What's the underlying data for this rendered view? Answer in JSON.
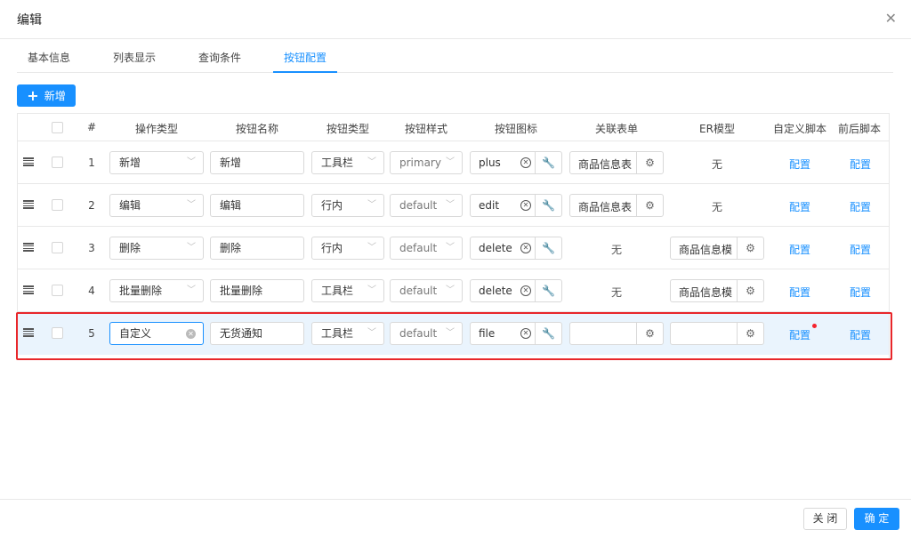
{
  "modal": {
    "title": "编辑",
    "close_glyph": "✕"
  },
  "tabs": [
    {
      "label": "基本信息",
      "active": false
    },
    {
      "label": "列表显示",
      "active": false
    },
    {
      "label": "查询条件",
      "active": false
    },
    {
      "label": "按钮配置",
      "active": true
    }
  ],
  "toolbar": {
    "add_label": "新增",
    "add_glyph": "+"
  },
  "table": {
    "headers": {
      "index": "#",
      "op_type": "操作类型",
      "btn_name": "按钮名称",
      "btn_type": "按钮类型",
      "btn_style": "按钮样式",
      "btn_icon": "按钮图标",
      "related_form": "关联表单",
      "er_model": "ER模型",
      "custom_script": "自定义脚本",
      "pre_post_script": "前后脚本"
    },
    "rows": [
      {
        "index": "1",
        "op_type": "新增",
        "btn_name": "新增",
        "btn_type": "工具栏",
        "btn_style": "primary",
        "icon": "plus",
        "related_form": "商品信息表",
        "er_model": "无",
        "custom_script": "配置",
        "pre_post_script": "配置"
      },
      {
        "index": "2",
        "op_type": "编辑",
        "btn_name": "编辑",
        "btn_type": "行内",
        "btn_style": "default",
        "icon": "edit",
        "related_form": "商品信息表",
        "er_model": "无",
        "custom_script": "配置",
        "pre_post_script": "配置"
      },
      {
        "index": "3",
        "op_type": "删除",
        "btn_name": "删除",
        "btn_type": "行内",
        "btn_style": "default",
        "icon": "delete",
        "related_form": "无",
        "er_model": "商品信息模",
        "custom_script": "配置",
        "pre_post_script": "配置"
      },
      {
        "index": "4",
        "op_type": "批量删除",
        "btn_name": "批量删除",
        "btn_type": "工具栏",
        "btn_style": "default",
        "icon": "delete",
        "related_form": "无",
        "er_model": "商品信息模",
        "custom_script": "配置",
        "pre_post_script": "配置"
      },
      {
        "index": "5",
        "op_type": "自定义",
        "btn_name": "无货通知",
        "btn_type": "工具栏",
        "btn_style": "default",
        "icon": "file",
        "related_form": "",
        "er_model": "",
        "custom_script": "配置",
        "pre_post_script": "配置"
      }
    ]
  },
  "footer": {
    "close_label": "关 闭",
    "ok_label": "确 定"
  },
  "colors": {
    "primary": "#1890ff",
    "highlight": "#e8262a",
    "selected_row": "#eaf4fd"
  }
}
